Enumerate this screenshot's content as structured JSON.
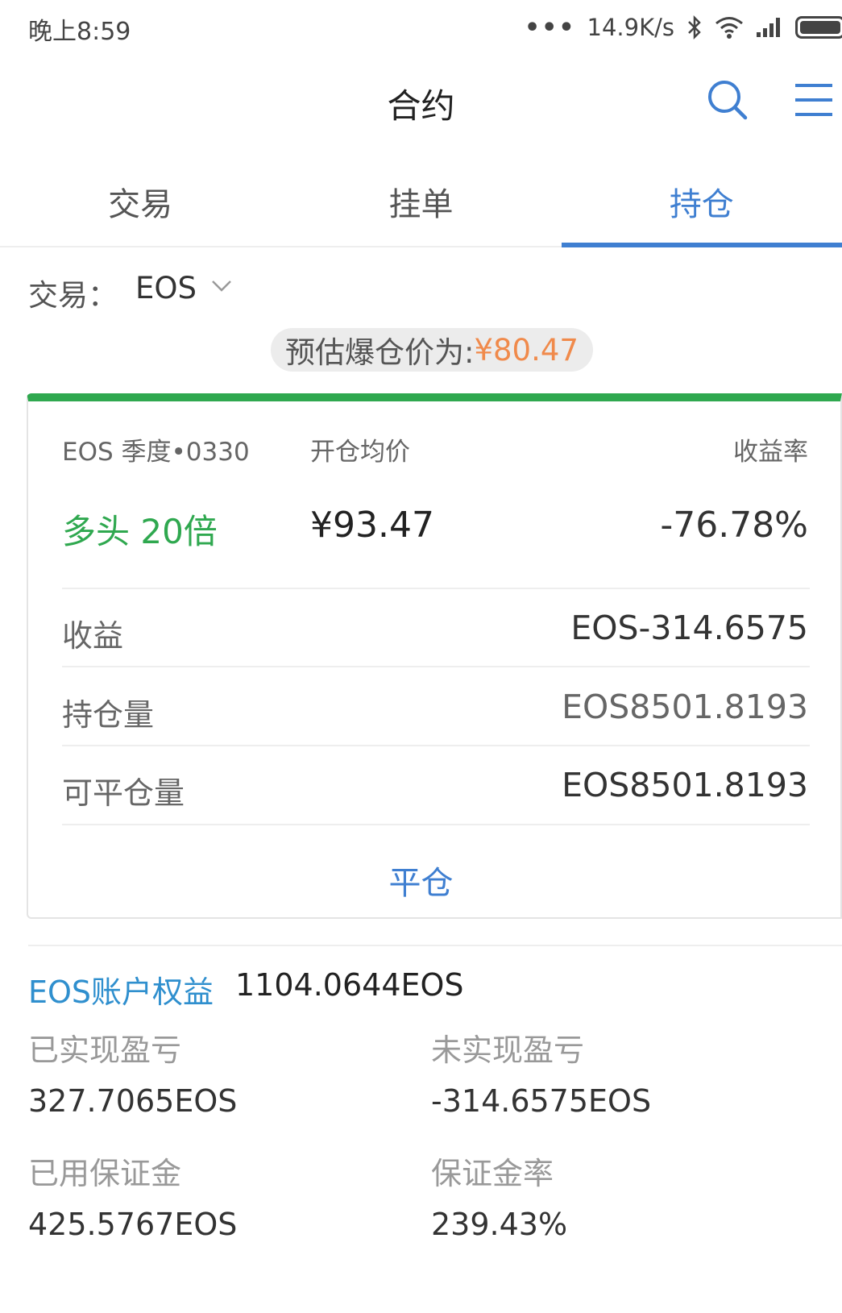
{
  "status_bar": {
    "time": "晚上8:59",
    "network_speed": "14.9K/s",
    "icons": [
      "more-dots-icon",
      "bluetooth-icon",
      "wifi-icon",
      "signal-icon",
      "battery-icon"
    ]
  },
  "header": {
    "title": "合约"
  },
  "tabs": [
    {
      "label": "交易",
      "active": false
    },
    {
      "label": "挂单",
      "active": false
    },
    {
      "label": "持仓",
      "active": true
    }
  ],
  "selector": {
    "label": "交易：",
    "value": "EOS"
  },
  "liquidation": {
    "label": "预估爆仓价为: ",
    "price": "¥80.47"
  },
  "position": {
    "contract_name": "EOS 季度•0330",
    "avg_price_label": "开仓均价",
    "yield_label": "收益率",
    "direction": "多头 20倍",
    "avg_price": "¥93.47",
    "yield": "-76.78%",
    "rows": [
      {
        "label": "收益",
        "value": "EOS-314.6575"
      },
      {
        "label": "持仓量",
        "value": "EOS8501.8193"
      },
      {
        "label": "可平仓量",
        "value": "EOS8501.8193"
      }
    ],
    "close_label": "平仓"
  },
  "account": {
    "title": "EOS账户权益",
    "value": "1104.0644EOS",
    "items": [
      {
        "label": "已实现盈亏",
        "value": "327.7065EOS"
      },
      {
        "label": "未实现盈亏",
        "value": "-314.6575EOS"
      },
      {
        "label": "已用保证金",
        "value": "425.5767EOS"
      },
      {
        "label": "保证金率",
        "value": "239.43%"
      }
    ]
  },
  "colors": {
    "accent_blue": "#3f7fd1",
    "long_green": "#2fa84f",
    "price_orange": "#f08a4b",
    "account_title_blue": "#2f8fce"
  }
}
